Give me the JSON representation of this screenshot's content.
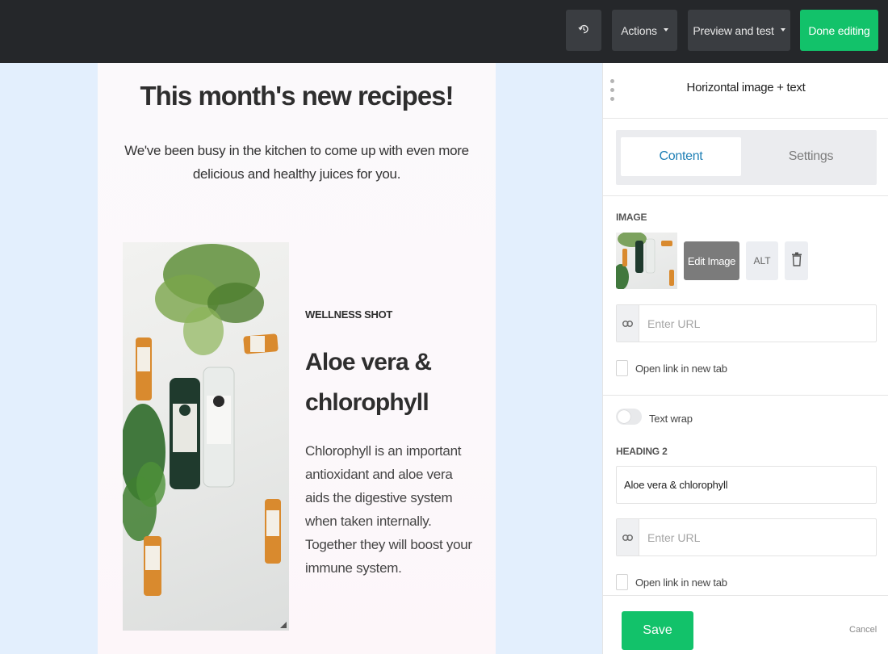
{
  "toolbar": {
    "history_icon": "history-icon",
    "actions_label": "Actions",
    "preview_label": "Preview and test",
    "done_label": "Done editing"
  },
  "email": {
    "title": "This month's new recipes!",
    "intro": "We've been busy in the kitchen to come up with even more delicious and healthy juices for you.",
    "card": {
      "kicker": "WELLNESS SHOT",
      "heading": "Aloe vera & chlorophyll",
      "body": "Chlorophyll is an important antioxidant and aloe vera aids the digestive system when taken internally. Together they will boost your immune system."
    }
  },
  "panel": {
    "title": "Horizontal image + text",
    "tabs": {
      "content": "Content",
      "settings": "Settings",
      "active": "content"
    },
    "image_section": {
      "label": "IMAGE",
      "edit_label": "Edit Image",
      "alt_label": "ALT",
      "url_placeholder": "Enter URL",
      "new_tab_label": "Open link in new tab",
      "new_tab_checked": false
    },
    "text_wrap": {
      "label": "Text wrap",
      "enabled": false
    },
    "heading_section": {
      "label": "HEADING 2",
      "value": "Aloe vera & chlorophyll",
      "url_placeholder": "Enter URL",
      "new_tab_label": "Open link in new tab",
      "new_tab_checked": false
    },
    "footer": {
      "save_label": "Save",
      "cancel_label": "Cancel"
    }
  },
  "colors": {
    "topbar": "#25272a",
    "accent_green": "#12c26a",
    "canvas_bg": "#e3effd",
    "tab_active_text": "#1e7fb5"
  }
}
